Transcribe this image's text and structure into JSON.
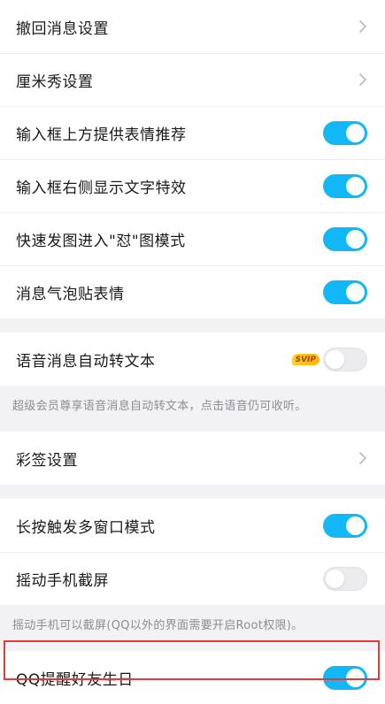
{
  "group1": {
    "items": [
      {
        "label": "撤回消息设置",
        "type": "chevron"
      },
      {
        "label": "厘米秀设置",
        "type": "chevron"
      },
      {
        "label": "输入框上方提供表情推荐",
        "type": "toggle",
        "on": true
      },
      {
        "label": "输入框右侧显示文字特效",
        "type": "toggle",
        "on": true
      },
      {
        "label": "快速发图进入\"怼\"图模式",
        "type": "toggle",
        "on": true
      },
      {
        "label": "消息气泡贴表情",
        "type": "toggle",
        "on": true
      }
    ]
  },
  "group2": {
    "label": "语音消息自动转文本",
    "badge": "SVIP",
    "on": false,
    "note": "超级会员尊享语音消息自动转文本，点击语音仍可收听。"
  },
  "group3": {
    "label": "彩签设置"
  },
  "group4": {
    "items": [
      {
        "label": "长按触发多窗口模式",
        "on": true
      },
      {
        "label": "摇动手机截屏",
        "on": false
      }
    ],
    "note": "摇动手机可以截屏(QQ以外的界面需要开启Root权限)。"
  },
  "group5": {
    "label": "QQ提醒好友生日",
    "on": true
  },
  "colors": {
    "toggle_on": "#12b7f5",
    "toggle_off": "#ececef",
    "highlight_border": "#e03a3a",
    "background": "#f2f2f4"
  },
  "icons": {
    "chevron": "chevron-right-icon"
  }
}
